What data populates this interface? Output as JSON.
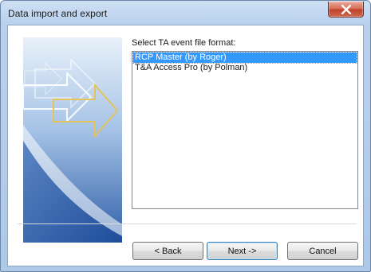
{
  "window": {
    "title": "Data import and export"
  },
  "main": {
    "prompt": "Select TA event file format:",
    "formats": [
      {
        "label": "RCP Master (by Roger)",
        "selected": true
      },
      {
        "label": "T&A Access Pro (by Polman)",
        "selected": false
      }
    ]
  },
  "buttons": {
    "back": "< Back",
    "next": "Next ->",
    "cancel": "Cancel"
  },
  "icons": {
    "close": "close-icon",
    "banner": "wizard-banner-image"
  },
  "colors": {
    "selection": "#3399ff",
    "close_button": "#c1412a",
    "frame": "#b9d1ed"
  }
}
